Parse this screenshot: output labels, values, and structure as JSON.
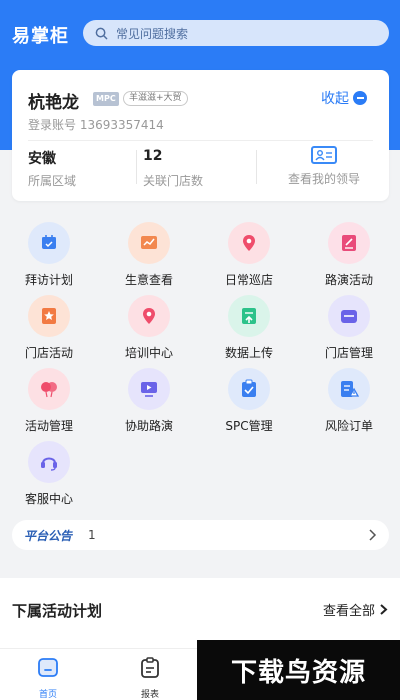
{
  "header": {
    "app_title": "易掌柜",
    "search_placeholder": "常见问题搜索",
    "search_icon": "search-icon"
  },
  "profile": {
    "name": "杭艳龙",
    "badge": "MPC",
    "region_tag": "羊滋滋+大贸",
    "collapse_label": "收起",
    "account": "登录账号 13693357414",
    "area_value": "安徽",
    "area_label": "所属区域",
    "stores_value": "12",
    "stores_label": "关联门店数",
    "leader_label": "查看我的领导",
    "leader_icon": "id-card-icon"
  },
  "menu": [
    {
      "label": "拜访计划",
      "icon": "calendar-icon",
      "bg": "#dfe9fb",
      "color": "#3a7ff0"
    },
    {
      "label": "生意查看",
      "icon": "chart-icon",
      "bg": "#fde3d6",
      "color": "#f2884f"
    },
    {
      "label": "日常巡店",
      "icon": "location-icon",
      "bg": "#fde0e4",
      "color": "#ef4d6b"
    },
    {
      "label": "路演活动",
      "icon": "note-icon",
      "bg": "#fde0e8",
      "color": "#e94b7a"
    },
    {
      "label": "门店活动",
      "icon": "star-icon",
      "bg": "#fde3d6",
      "color": "#f27a43"
    },
    {
      "label": "培训中心",
      "icon": "location-icon",
      "bg": "#fde0e4",
      "color": "#ef4d6b"
    },
    {
      "label": "数据上传",
      "icon": "upload-icon",
      "bg": "#daf4ea",
      "color": "#2cc28a"
    },
    {
      "label": "门店管理",
      "icon": "store-icon",
      "bg": "#e6e4fc",
      "color": "#6a63e8"
    },
    {
      "label": "活动管理",
      "icon": "balloon-icon",
      "bg": "#fde0e4",
      "color": "#ef4d6b"
    },
    {
      "label": "协助路演",
      "icon": "screen-icon",
      "bg": "#e6e4fc",
      "color": "#6a63e8"
    },
    {
      "label": "SPC管理",
      "icon": "clipboard-icon",
      "bg": "#dfe9fb",
      "color": "#3a7ff0"
    },
    {
      "label": "风险订单",
      "icon": "warning-doc-icon",
      "bg": "#dfe9fb",
      "color": "#3a7ff0"
    },
    {
      "label": "客服中心",
      "icon": "headset-icon",
      "bg": "#e6e4fc",
      "color": "#6a63e8"
    }
  ],
  "notice": {
    "tag": "平台公告",
    "count": "1"
  },
  "section": {
    "title": "下属活动计划",
    "more": "查看全部"
  },
  "tabbar": [
    {
      "label": "首页",
      "icon": "home-icon",
      "active": true
    },
    {
      "label": "报表",
      "icon": "report-icon",
      "active": false
    }
  ],
  "watermark": "下载鸟资源",
  "colors": {
    "primary": "#2b7cf6",
    "background": "#f2f3f5"
  }
}
